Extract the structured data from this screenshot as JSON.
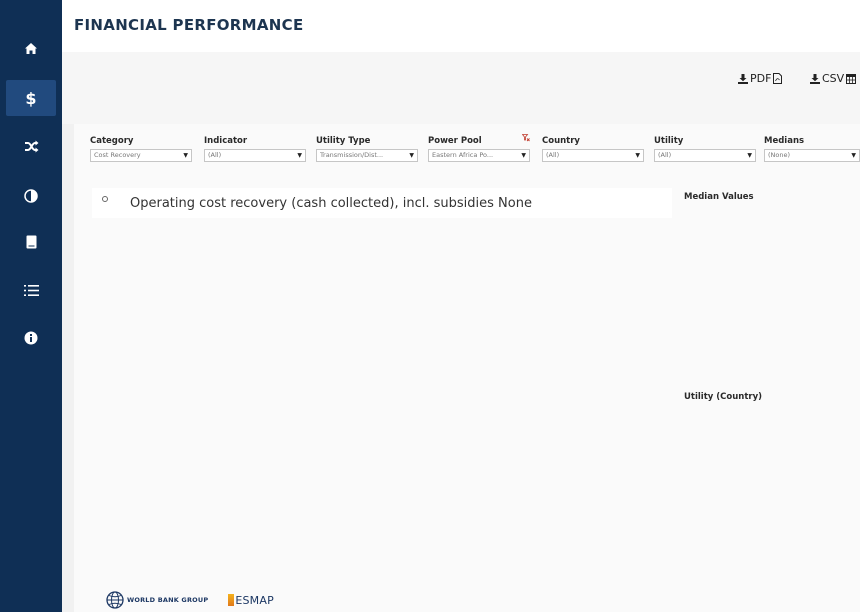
{
  "header": {
    "title": "FINANCIAL PERFORMANCE"
  },
  "sidebar": {
    "items": [
      {
        "icon": "home-icon",
        "active": false
      },
      {
        "icon": "dollar-icon",
        "glyph": "$",
        "active": true
      },
      {
        "icon": "shuffle-icon",
        "active": false
      },
      {
        "icon": "contrast-icon",
        "active": false
      },
      {
        "icon": "document-icon",
        "active": false
      },
      {
        "icon": "list-icon",
        "active": false
      },
      {
        "icon": "info-icon",
        "active": false
      }
    ]
  },
  "export": {
    "pdf_label": "PDF",
    "csv_label": "CSV",
    "pdf_icon": "pdf-file-icon",
    "csv_icon": "table-icon"
  },
  "filters": {
    "category": {
      "label": "Category",
      "value": "Cost Recovery"
    },
    "indicator": {
      "label": "Indicator",
      "value": "(All)"
    },
    "utility_type": {
      "label": "Utility Type",
      "value": "Transmission/Dist..."
    },
    "power_pool": {
      "label": "Power Pool",
      "value": "Eastern Africa Po...",
      "filter_icon": "clear-filter-icon"
    },
    "country": {
      "label": "Country",
      "value": "(All)"
    },
    "utility": {
      "label": "Utility",
      "value": "(All)"
    },
    "medians": {
      "label": "Medians",
      "value": "(None)"
    }
  },
  "indicator_title": "Operating cost recovery (cash collected), incl. subsidies None",
  "median_heading": "Median Values",
  "utility_heading": "Utility (Country)",
  "footer": {
    "worldbank_label": "WORLD BANK GROUP",
    "esmap_label": "ESMAP"
  },
  "colors": {
    "sidebar": "#0f2f55",
    "sidebar_active": "#214a7e",
    "title": "#1d3550",
    "funnel": "#c0392b"
  }
}
